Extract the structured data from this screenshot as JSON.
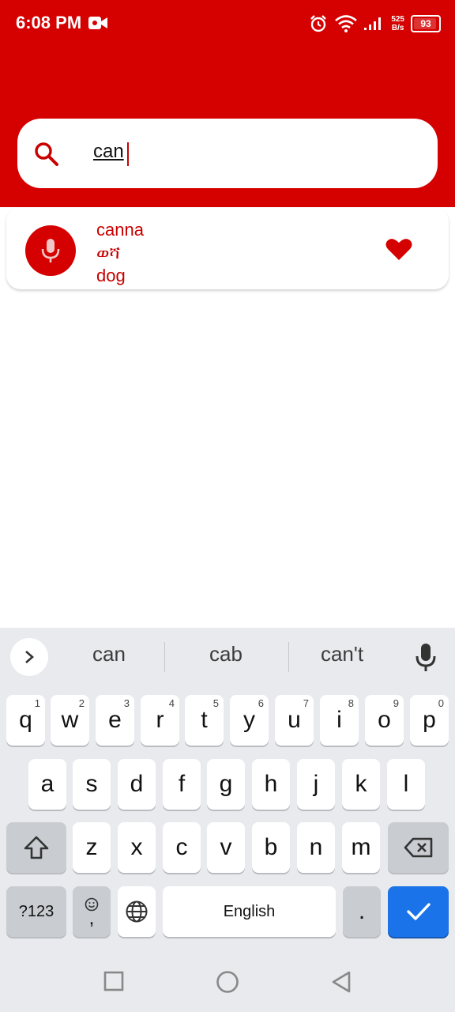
{
  "status_bar": {
    "time": "6:08 PM",
    "network_speed_top": "525",
    "network_speed_unit": "B/s",
    "battery": "93",
    "icons": [
      "video-record-icon",
      "alarm-icon",
      "wifi-icon",
      "signal-icon",
      "battery-icon"
    ]
  },
  "search": {
    "query": "can",
    "icon": "search-icon"
  },
  "results": [
    {
      "word": "canna",
      "translation": "ወሻ",
      "meaning": "dog",
      "favorite": true
    }
  ],
  "colors": {
    "primary": "#d50000",
    "text_accent": "#c80000",
    "keyboard_bg": "#e8eaed",
    "action_key": "#1a73e8"
  },
  "keyboard": {
    "suggestions": [
      "can",
      "cab",
      "can't"
    ],
    "row1": [
      {
        "k": "q",
        "n": "1"
      },
      {
        "k": "w",
        "n": "2"
      },
      {
        "k": "e",
        "n": "3"
      },
      {
        "k": "r",
        "n": "4"
      },
      {
        "k": "t",
        "n": "5"
      },
      {
        "k": "y",
        "n": "6"
      },
      {
        "k": "u",
        "n": "7"
      },
      {
        "k": "i",
        "n": "8"
      },
      {
        "k": "o",
        "n": "9"
      },
      {
        "k": "p",
        "n": "0"
      }
    ],
    "row2": [
      "a",
      "s",
      "d",
      "f",
      "g",
      "h",
      "j",
      "k",
      "l"
    ],
    "row3": [
      "z",
      "x",
      "c",
      "v",
      "b",
      "n",
      "m"
    ],
    "symbols_label": "?123",
    "comma_label": ",",
    "space_label": "English",
    "period_label": "."
  }
}
